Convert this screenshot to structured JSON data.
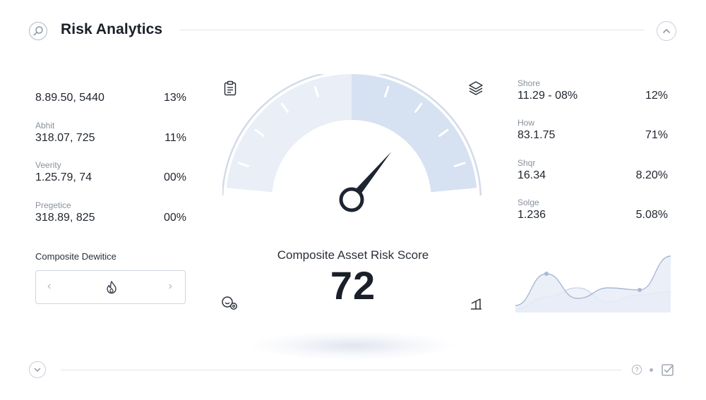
{
  "header": {
    "title": "Risk Analytics",
    "icons": {
      "search": "search-icon",
      "collapse": "chevron-up-icon"
    }
  },
  "left_metrics": [
    {
      "label": "",
      "value": "8.89.50, 5440",
      "percent": "13%"
    },
    {
      "label": "Abhit",
      "value": "318.07, 725",
      "percent": "11%"
    },
    {
      "label": "Veerity",
      "value": "1.25.79, 74",
      "percent": "00%"
    },
    {
      "label": "Pregetice",
      "value": "318.89, 825",
      "percent": "00%"
    }
  ],
  "composite_selector": {
    "label": "Composite Dewitice",
    "prev": "‹",
    "next": "›",
    "icon": "flame-icon"
  },
  "right_metrics": [
    {
      "label": "Shore",
      "value": "11.29 - 08%",
      "percent": "12%"
    },
    {
      "label": "How",
      "value": "83.1.75",
      "percent": "71%"
    },
    {
      "label": "Shqr",
      "value": "16.34",
      "percent": "8.20%"
    },
    {
      "label": "Solge",
      "value": "1.236",
      "percent": "5.08%"
    }
  ],
  "gauge": {
    "label": "Composite Asset Risk Score",
    "value": "72",
    "score": 72,
    "max": 100,
    "colors": {
      "track": "#e9eef7",
      "fill": "#d6e1f2",
      "ring": "#d3dbe8",
      "needle": "#1e2430"
    },
    "corner_icons": [
      "clipboard-icon",
      "layers-icon",
      "settings-icon",
      "flag-icon"
    ]
  },
  "mini_chart": {
    "series_a": [
      10,
      55,
      20,
      35,
      32,
      80
    ],
    "series_b": [
      5,
      22,
      35,
      15,
      25,
      30
    ],
    "colors": {
      "line": "#a9b8d6",
      "fill": "#e6ecf7"
    }
  },
  "footer": {
    "icons": [
      "chevron-down-icon",
      "help-icon",
      "dot-icon",
      "checkbox-icon"
    ],
    "help": "?"
  }
}
